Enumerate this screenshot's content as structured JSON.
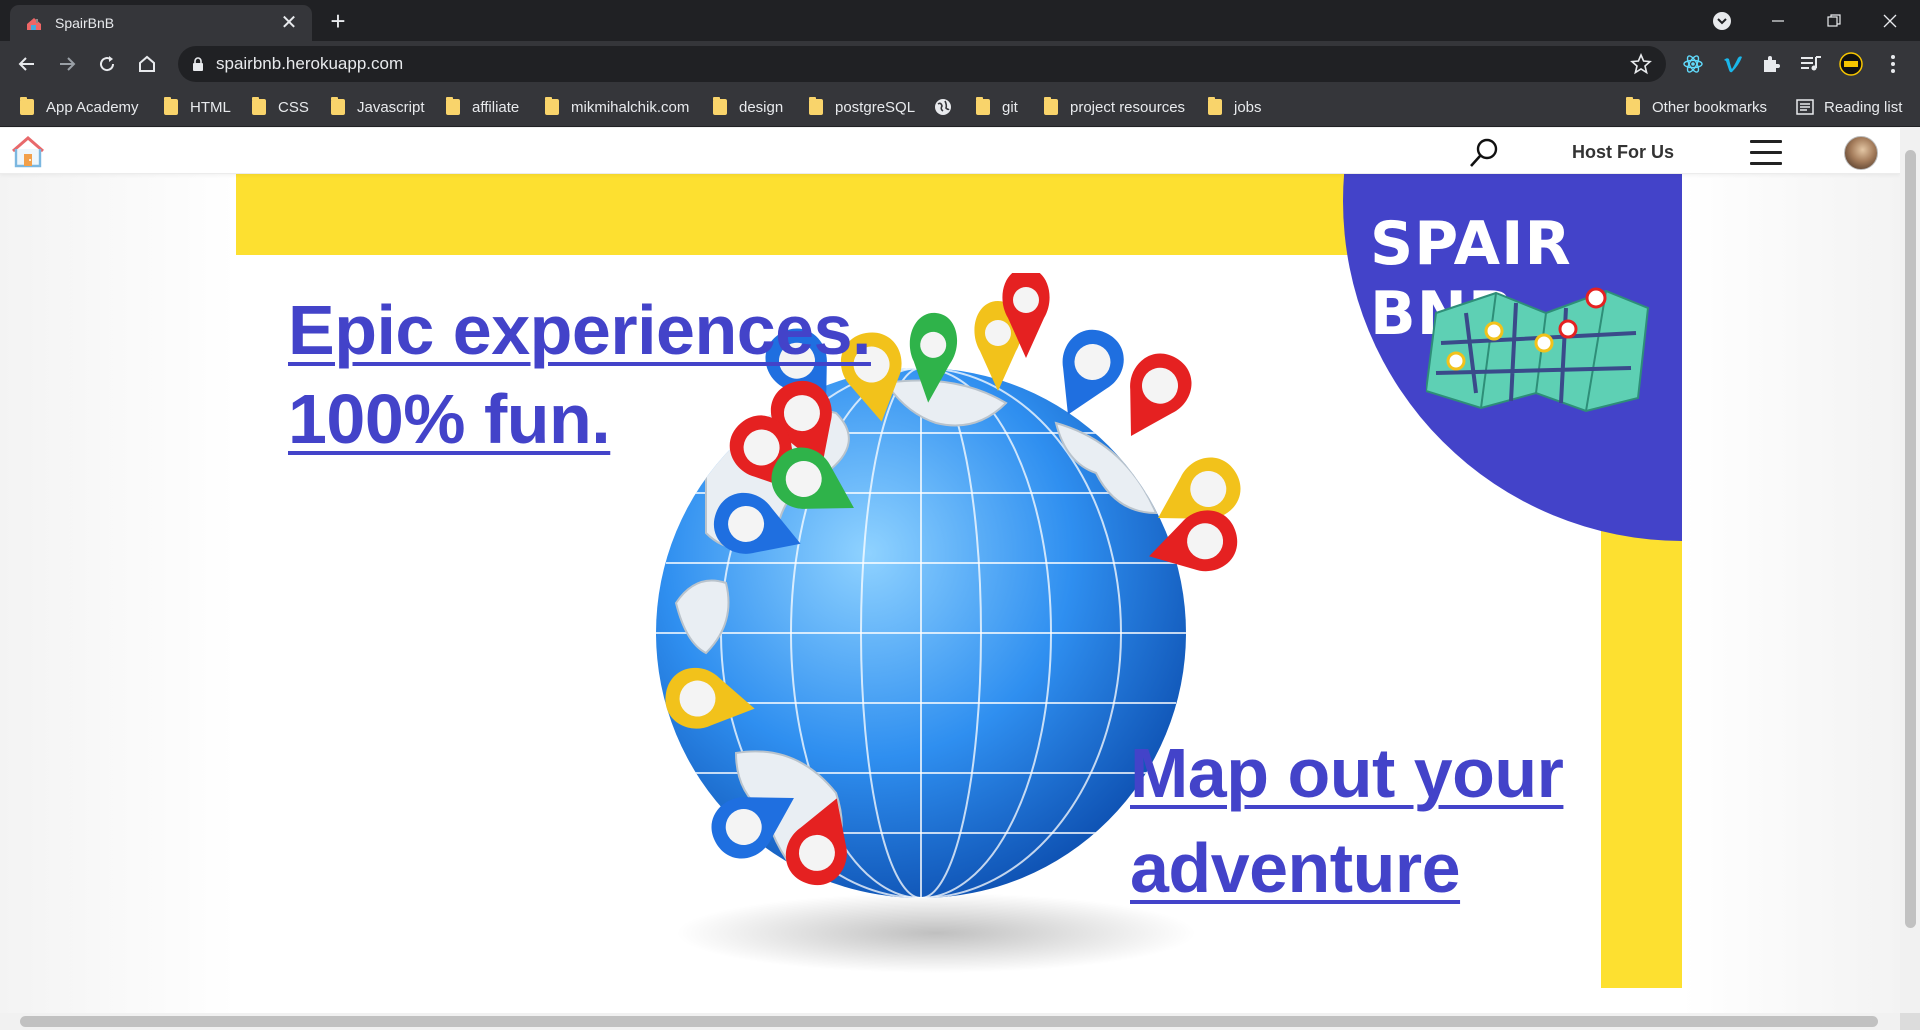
{
  "browser": {
    "tab_title": "SpairBnB",
    "url": "spairbnb.herokuapp.com",
    "bookmarks": [
      {
        "label": "App Academy"
      },
      {
        "label": "HTML"
      },
      {
        "label": "CSS"
      },
      {
        "label": "Javascript"
      },
      {
        "label": "affiliate"
      },
      {
        "label": "mikmihalchik.com"
      },
      {
        "label": "design"
      },
      {
        "label": "postgreSQL"
      },
      {
        "label": "git"
      },
      {
        "label": "project resources"
      },
      {
        "label": "jobs"
      }
    ],
    "other_bookmarks": "Other bookmarks",
    "reading_list": "Reading list"
  },
  "header": {
    "host_link": "Host For Us"
  },
  "hero": {
    "headline_line1": "Epic experiences.",
    "headline_line2": "100% fun.",
    "cta_line1": "Map out your",
    "cta_line2": "adventure",
    "brand": "SPAIR BNB"
  },
  "colors": {
    "accent": "#4343c9",
    "yellow": "#fde030",
    "chrome_dark": "#202124",
    "chrome_mid": "#35363a"
  }
}
